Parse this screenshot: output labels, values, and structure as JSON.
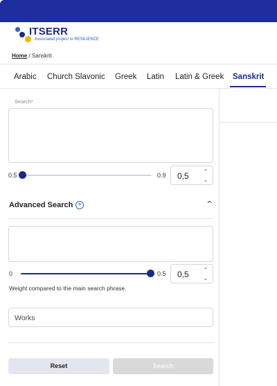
{
  "header": {
    "brand": "ITSERR",
    "tagline": "Associated project to RESILIENCE"
  },
  "breadcrumb": {
    "home": "Home",
    "separator": " / ",
    "current": "Sanskrit"
  },
  "tabs": [
    {
      "label": "Arabic",
      "active": false
    },
    {
      "label": "Church Slavonic",
      "active": false
    },
    {
      "label": "Greek",
      "active": false
    },
    {
      "label": "Latin",
      "active": false
    },
    {
      "label": "Latin & Greek",
      "active": false
    },
    {
      "label": "Sanskrit",
      "active": true
    }
  ],
  "search": {
    "label": "Search*",
    "slider": {
      "min_label": "0.5",
      "max_label": "0.9",
      "value_fraction": 0
    },
    "value": "0,5"
  },
  "advanced": {
    "title": "Advanced Search",
    "plus_icon": "plus-circle-icon",
    "toggle_icon": "chevron-up-icon",
    "slider": {
      "min_label": "0",
      "max_label": "0.5",
      "value_fraction": 1
    },
    "value": "0,5",
    "weight_note": "Weight compared to the main search phrase.",
    "works_placeholder": "Works"
  },
  "buttons": {
    "reset": "Reset",
    "search": "Search"
  },
  "colors": {
    "brand": "#1b2a8a",
    "topbar": "#1f2e9e",
    "accent": "#2a62c9",
    "logo_yellow": "#f4b400"
  }
}
